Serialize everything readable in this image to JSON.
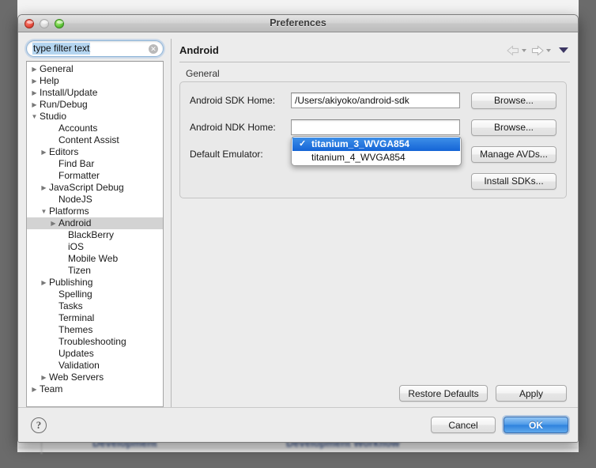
{
  "window": {
    "title": "Preferences",
    "traffic_lights": [
      "close-red",
      "minimize-gray",
      "zoom-green"
    ]
  },
  "background_page": {
    "text_left": "Development",
    "text_right": "Development Workflow"
  },
  "filter": {
    "value": "type filter text",
    "placeholder": "type filter text",
    "clear_icon": "clear-icon",
    "clear_glyph": "✕"
  },
  "tree": {
    "items": [
      {
        "label": "General",
        "indent": 0,
        "twisty": "collapsed",
        "selected": false
      },
      {
        "label": "Help",
        "indent": 0,
        "twisty": "collapsed",
        "selected": false
      },
      {
        "label": "Install/Update",
        "indent": 0,
        "twisty": "collapsed",
        "selected": false
      },
      {
        "label": "Run/Debug",
        "indent": 0,
        "twisty": "collapsed",
        "selected": false
      },
      {
        "label": "Studio",
        "indent": 0,
        "twisty": "expanded",
        "selected": false
      },
      {
        "label": "Accounts",
        "indent": 2,
        "twisty": "none",
        "selected": false
      },
      {
        "label": "Content Assist",
        "indent": 2,
        "twisty": "none",
        "selected": false
      },
      {
        "label": "Editors",
        "indent": 1,
        "twisty": "collapsed",
        "selected": false
      },
      {
        "label": "Find Bar",
        "indent": 2,
        "twisty": "none",
        "selected": false
      },
      {
        "label": "Formatter",
        "indent": 2,
        "twisty": "none",
        "selected": false
      },
      {
        "label": "JavaScript Debug",
        "indent": 1,
        "twisty": "collapsed",
        "selected": false
      },
      {
        "label": "NodeJS",
        "indent": 2,
        "twisty": "none",
        "selected": false
      },
      {
        "label": "Platforms",
        "indent": 1,
        "twisty": "expanded",
        "selected": false
      },
      {
        "label": "Android",
        "indent": 2,
        "twisty": "collapsed",
        "selected": true
      },
      {
        "label": "BlackBerry",
        "indent": 3,
        "twisty": "none",
        "selected": false
      },
      {
        "label": "iOS",
        "indent": 3,
        "twisty": "none",
        "selected": false
      },
      {
        "label": "Mobile Web",
        "indent": 3,
        "twisty": "none",
        "selected": false
      },
      {
        "label": "Tizen",
        "indent": 3,
        "twisty": "none",
        "selected": false
      },
      {
        "label": "Publishing",
        "indent": 1,
        "twisty": "collapsed",
        "selected": false
      },
      {
        "label": "Spelling",
        "indent": 2,
        "twisty": "none",
        "selected": false
      },
      {
        "label": "Tasks",
        "indent": 2,
        "twisty": "none",
        "selected": false
      },
      {
        "label": "Terminal",
        "indent": 2,
        "twisty": "none",
        "selected": false
      },
      {
        "label": "Themes",
        "indent": 2,
        "twisty": "none",
        "selected": false
      },
      {
        "label": "Troubleshooting",
        "indent": 2,
        "twisty": "none",
        "selected": false
      },
      {
        "label": "Updates",
        "indent": 2,
        "twisty": "none",
        "selected": false
      },
      {
        "label": "Validation",
        "indent": 2,
        "twisty": "none",
        "selected": false
      },
      {
        "label": "Web Servers",
        "indent": 1,
        "twisty": "collapsed",
        "selected": false
      },
      {
        "label": "Team",
        "indent": 0,
        "twisty": "collapsed",
        "selected": false
      }
    ],
    "twisty_collapsed_glyph": "▶",
    "twisty_expanded_glyph": "▼"
  },
  "panel": {
    "title": "Android",
    "nav": {
      "back_icon": "back-arrow-icon",
      "back_menu_icon": "back-dropdown-icon",
      "forward_icon": "forward-arrow-icon",
      "forward_menu_icon": "forward-dropdown-icon",
      "menu_icon": "view-menu-icon"
    },
    "group_label": "General",
    "fields": [
      {
        "label": "Android SDK Home:",
        "value": "/Users/akiyoko/android-sdk",
        "placeholder": "",
        "button": "Browse..."
      },
      {
        "label": "Android NDK Home:",
        "value": "",
        "placeholder": "",
        "button": "Browse..."
      },
      {
        "label": "Default Emulator:",
        "value": "titanium_3_WVGA854",
        "placeholder": "",
        "button": "Manage AVDs..."
      }
    ],
    "install_sdks_button": "Install SDKs...",
    "emulator_popup": {
      "check_glyph": "✓",
      "options": [
        {
          "label": "titanium_3_WVGA854",
          "checked": true
        },
        {
          "label": "titanium_4_WVGA854",
          "checked": false
        }
      ]
    },
    "restore_defaults_button": "Restore Defaults",
    "apply_button": "Apply"
  },
  "footer": {
    "help_icon": "help-icon",
    "help_glyph": "?",
    "cancel_button": "Cancel",
    "ok_button": "OK"
  },
  "colors": {
    "desktop": "#6b6b6b",
    "dialog_bg": "#ececec",
    "selection_blue": "#1464d6",
    "tree_selection_gray": "#d3d3d3",
    "default_button_blue": "#4e9ae8",
    "filter_selection": "#b4d5f0",
    "background_text_blue": "#1d3a78"
  }
}
